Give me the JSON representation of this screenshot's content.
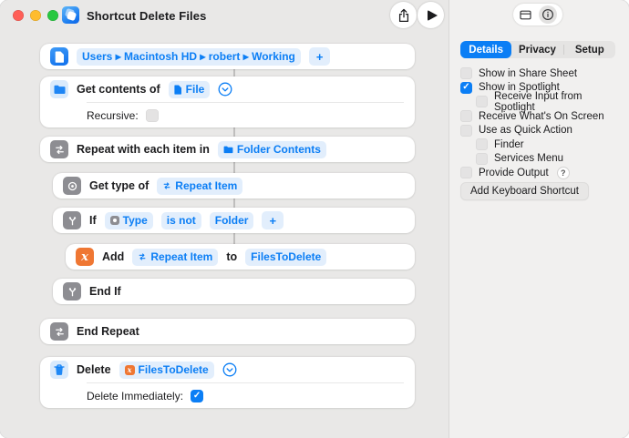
{
  "titlebar": {
    "title": "Shortcut Delete Files"
  },
  "canvas": {
    "path": {
      "text": "Users ▸ Macintosh HD ▸ robert ▸ Working",
      "add_label": "+"
    },
    "get_contents": {
      "label": "Get contents of",
      "input": "File",
      "recursive_label": "Recursive:",
      "recursive_checked": false
    },
    "repeat": {
      "label": "Repeat with each item in",
      "input": "Folder Contents"
    },
    "get_type": {
      "label": "Get type of",
      "input": "Repeat Item"
    },
    "if_block": {
      "label": "If",
      "subject": "Type",
      "operator": "is not",
      "comparison": "Folder",
      "add_label": "+"
    },
    "add_to_var": {
      "label": "Add",
      "item": "Repeat Item",
      "connector": "to",
      "variable": "FilesToDelete"
    },
    "end_if": {
      "label": "End If"
    },
    "end_repeat": {
      "label": "End Repeat"
    },
    "delete": {
      "label": "Delete",
      "variable": "FilesToDelete",
      "immediately_label": "Delete Immediately:",
      "immediately_checked": true
    }
  },
  "inspector": {
    "tabs": [
      {
        "label": "Details",
        "selected": true
      },
      {
        "label": "Privacy",
        "selected": false
      },
      {
        "label": "Setup",
        "selected": false
      }
    ],
    "options": [
      {
        "label": "Show in Share Sheet",
        "checked": false,
        "indent": 0
      },
      {
        "label": "Show in Spotlight",
        "checked": true,
        "indent": 0
      },
      {
        "label": "Receive Input from Spotlight",
        "checked": false,
        "indent": 1
      },
      {
        "label": "Receive What's On Screen",
        "checked": false,
        "indent": 0
      },
      {
        "label": "Use as Quick Action",
        "checked": false,
        "indent": 0
      },
      {
        "label": "Finder",
        "checked": false,
        "indent": 1
      },
      {
        "label": "Services Menu",
        "checked": false,
        "indent": 1
      },
      {
        "label": "Provide Output",
        "checked": false,
        "indent": 0
      }
    ],
    "help_badge": "?",
    "keyboard_button": "Add Keyboard Shortcut"
  },
  "colors": {
    "accent_blue": "#0b7ef5",
    "variable_orange": "#ef7733",
    "icon_gray": "#8d8d92"
  }
}
